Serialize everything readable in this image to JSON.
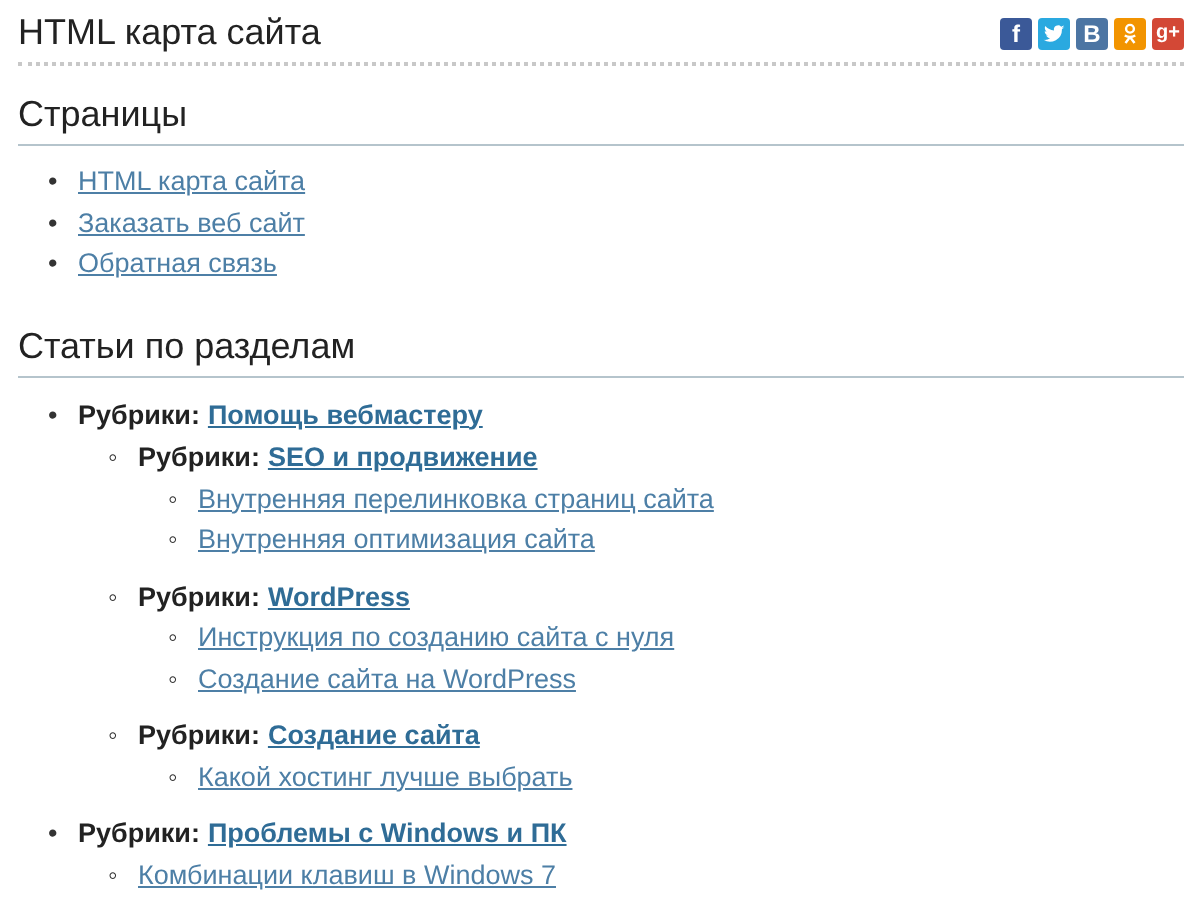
{
  "page": {
    "title": "HTML карта сайта"
  },
  "share_buttons": [
    {
      "kind": "facebook",
      "label": "f"
    },
    {
      "kind": "twitter"
    },
    {
      "kind": "vk",
      "label": "B"
    },
    {
      "kind": "odnoklassniki"
    },
    {
      "kind": "googleplus",
      "label": "g+"
    }
  ],
  "sections": [
    {
      "title": "Страницы",
      "items": [
        {
          "kind": "post",
          "marker": "•",
          "label": "HTML карта сайта"
        },
        {
          "kind": "post",
          "marker": "•",
          "label": "Заказать веб сайт"
        },
        {
          "kind": "post",
          "marker": "•",
          "label": "Обратная связь"
        }
      ]
    },
    {
      "title": "Статьи по разделам",
      "items": [
        {
          "kind": "category",
          "marker": "•",
          "prefix": "Рубрики:",
          "label": "Помощь вебмастеру",
          "children": [
            {
              "kind": "category",
              "marker": "◦",
              "prefix": "Рубрики:",
              "label": "SEO и продвижение",
              "children": [
                {
                  "kind": "post",
                  "marker": "◦",
                  "label": "Внутренняя перелинковка страниц сайта"
                },
                {
                  "kind": "post",
                  "marker": "◦",
                  "label": "Внутренняя оптимизация сайта"
                }
              ]
            },
            {
              "kind": "category",
              "marker": "◦",
              "prefix": "Рубрики:",
              "label": "WordPress",
              "children": [
                {
                  "kind": "post",
                  "marker": "◦",
                  "label": "Инструкция по созданию сайта с нуля"
                },
                {
                  "kind": "post",
                  "marker": "◦",
                  "label": "Создание сайта на WordPress"
                }
              ]
            },
            {
              "kind": "category",
              "marker": "◦",
              "prefix": "Рубрики:",
              "label": "Создание сайта",
              "children": [
                {
                  "kind": "post",
                  "marker": "◦",
                  "label": "Какой хостинг лучше выбрать"
                }
              ]
            }
          ]
        },
        {
          "kind": "category",
          "marker": "•",
          "prefix": "Рубрики:",
          "label": "Проблемы с Windows и ПК",
          "children": [
            {
              "kind": "post",
              "marker": "◦",
              "label": "Комбинации клавиш в Windows 7"
            }
          ]
        }
      ]
    }
  ]
}
